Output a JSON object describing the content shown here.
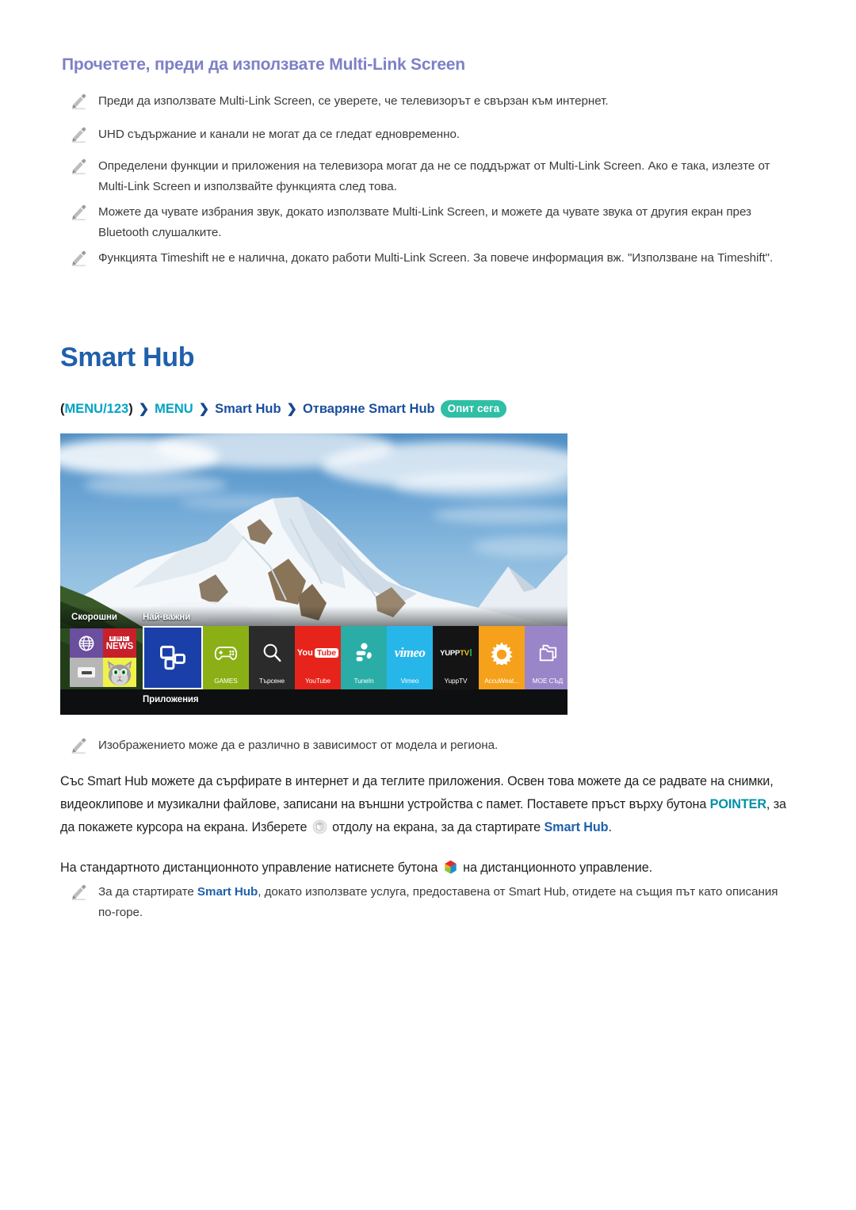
{
  "section": {
    "subheading": "Прочетете, преди да използвате Multi-Link Screen",
    "heading": "Smart Hub"
  },
  "notes_top": [
    "Преди да използвате Multi-Link Screen, се уверете, че телевизорът е свързан към интернет.",
    "UHD съдържание и канали не могат да се гледат едновременно.",
    "Определени функции и приложения на телевизора могат да не се поддържат от Multi-Link Screen. Ако е така, излезте от Multi-Link Screen и използвайте функцията след това.",
    "Можете да чувате избрания звук, докато използвате Multi-Link Screen, и можете да чувате звука от другия екран през Bluetooth слушалките.",
    "Функцията Timeshift не е налична, докато работи Multi-Link Screen. За повече информация вж. \"Използване на Timeshift\"."
  ],
  "breadcrumb": {
    "open_paren": "(",
    "menu123": "MENU/123",
    "close_paren": ")",
    "chevron": "❯",
    "menu": "MENU",
    "smart_hub": "Smart Hub",
    "open_smart_hub": "Отваряне Smart Hub",
    "try_now_badge": "Опит сега"
  },
  "tv_screen": {
    "row_labels": {
      "recent": "Скорошни",
      "featured": "Най-важни",
      "apps": "Приложения"
    },
    "recent_tiles": [
      {
        "name": "web-browser",
        "label": ""
      },
      {
        "name": "bbc-news",
        "label": "NEWS",
        "mark": "BBC"
      },
      {
        "name": "source-hdmi",
        "label": ""
      },
      {
        "name": "talking-tom",
        "label": ""
      }
    ],
    "hub_tile": {
      "name": "smart-hub-apps",
      "label": ""
    },
    "app_tiles": [
      {
        "label": "GAMES",
        "color": "#8bb016",
        "icon": "gamepad-icon"
      },
      {
        "label": "Търсене",
        "color": "#2b2b2b",
        "icon": "search-icon"
      },
      {
        "label": "YouTube",
        "color": "#e7241b",
        "icon": "youtube-icon",
        "logo_you": "You",
        "logo_tube": "Tube"
      },
      {
        "label": "TuneIn",
        "color": "#2aada6",
        "icon": "tunein-icon"
      },
      {
        "label": "Vimeo",
        "color": "#27b6ea",
        "icon": "vimeo-icon",
        "logo": "vimeo"
      },
      {
        "label": "YuppTV",
        "color": "#141414",
        "icon": "yupptv-icon",
        "logo_yupp": "YUPP",
        "logo_tv": "TV"
      },
      {
        "label": "AccuWeat...",
        "color": "#f5a11b",
        "icon": "sun-icon"
      },
      {
        "label": "MOE СЪД",
        "color": "#9a85c9",
        "icon": "folders-icon"
      }
    ]
  },
  "notes_figure": "Изображението може да е различно в зависимост от модела и региона.",
  "paragraph_main": {
    "part1": "Със Smart Hub можете да сърфирате в интернет и да теглите приложения. Освен това можете да се радвате на снимки, видеоклипове и музикални файлове, записани на външни устройства с памет. Поставете пръст върху бутона ",
    "pointer": "POINTER",
    "part2": ", за да покажете курсора на екрана. Изберете ",
    "part3": " отдолу на екрана, за да стартирате ",
    "smart_hub": "Smart Hub",
    "part4": "."
  },
  "paragraph_remote": {
    "part1": "На стандартното дистанционното управление натиснете бутона ",
    "part2": " на дистанционното управление."
  },
  "note_bottom": {
    "part1": "За да стартирате ",
    "smart_hub": "Smart Hub",
    "part2": ", докато използвате услуга, предоставена от Smart Hub, отидете на същия път като описания по-горе."
  },
  "colors": {
    "subheading": "#7d80c6",
    "heading": "#1f60ab",
    "accent_teal": "#00a3c4",
    "accent_navy": "#1a4e9e",
    "badge_bg": "#2ebfa5",
    "body_text": "#231f20",
    "note_text": "#3b3b3b"
  }
}
